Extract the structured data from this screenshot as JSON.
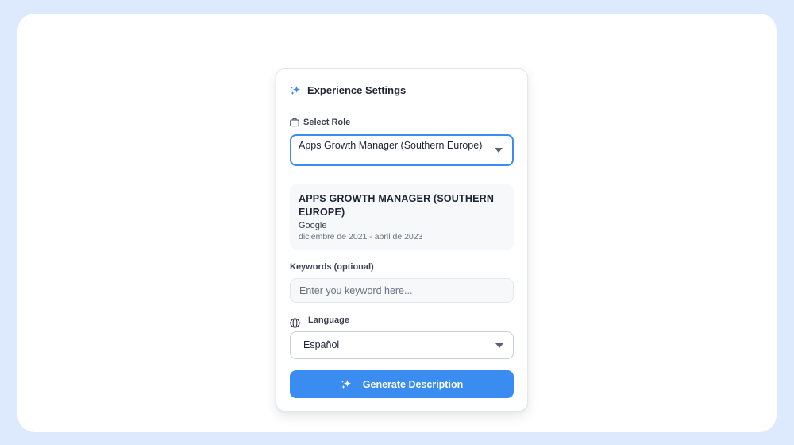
{
  "card": {
    "title": "Experience Settings",
    "title_icon": "sparkles-icon"
  },
  "role": {
    "label": "Select Role",
    "label_icon": "briefcase-icon",
    "selected": "Apps Growth Manager (Southern Europe)",
    "dropdown_icon": "caret-down-icon"
  },
  "role_info": {
    "title": "APPS GROWTH MANAGER (SOUTHERN EUROPE)",
    "company": "Google",
    "dates": "diciembre de 2021 - abril de 2023"
  },
  "keywords": {
    "label": "Keywords (optional)",
    "placeholder": "Enter you keyword here...",
    "value": ""
  },
  "language": {
    "label": "Language",
    "label_icon": "globe-icon",
    "selected": "Español",
    "dropdown_icon": "caret-down-icon"
  },
  "generate_button": {
    "label": "Generate Description",
    "icon": "sparkles-icon"
  },
  "colors": {
    "accent": "#3b8cf0",
    "page_background": "#dde9fc",
    "card_background": "#ffffff",
    "panel_background": "#f7f8fa",
    "text_primary": "#1e2433",
    "text_muted": "#6b7280"
  }
}
